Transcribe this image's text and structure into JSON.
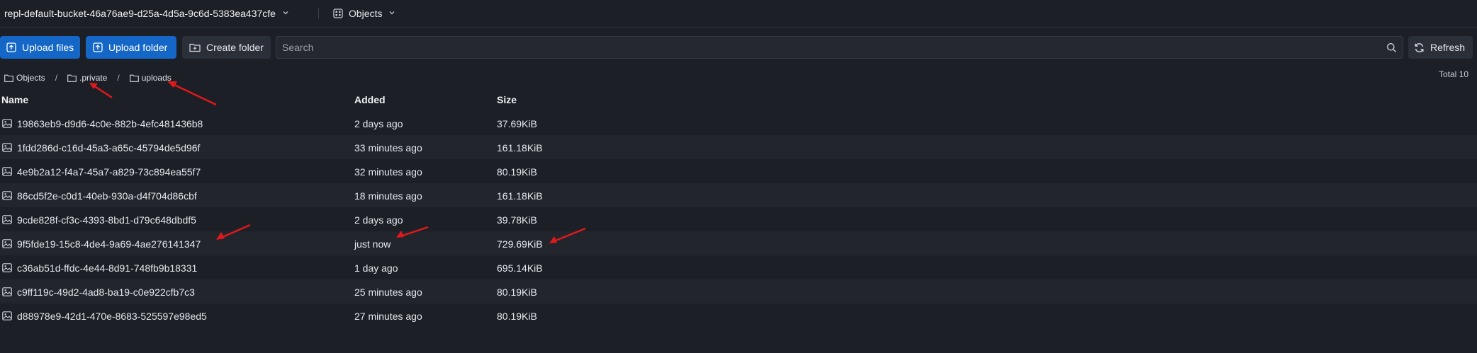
{
  "header": {
    "bucket_name": "repl-default-bucket-46a76ae9-d25a-4d5a-9c6d-5383ea437cfe",
    "view_label": "Objects"
  },
  "toolbar": {
    "upload_files_label": "Upload files",
    "upload_folder_label": "Upload folder",
    "create_folder_label": "Create folder",
    "search_placeholder": "Search",
    "refresh_label": "Refresh"
  },
  "breadcrumb": {
    "items": [
      "Objects",
      ".private",
      "uploads"
    ],
    "separator": "/"
  },
  "total_label": "Total 10",
  "table": {
    "columns": [
      "Name",
      "Added",
      "Size"
    ],
    "rows": [
      {
        "name": "19863eb9-d9d6-4c0e-882b-4efc481436b8",
        "added": "2 days ago",
        "size": "37.69KiB"
      },
      {
        "name": "1fdd286d-c16d-45a3-a65c-45794de5d96f",
        "added": "33 minutes ago",
        "size": "161.18KiB"
      },
      {
        "name": "4e9b2a12-f4a7-45a7-a829-73c894ea55f7",
        "added": "32 minutes ago",
        "size": "80.19KiB"
      },
      {
        "name": "86cd5f2e-c0d1-40eb-930a-d4f704d86cbf",
        "added": "18 minutes ago",
        "size": "161.18KiB"
      },
      {
        "name": "9cde828f-cf3c-4393-8bd1-d79c648dbdf5",
        "added": "2 days ago",
        "size": "39.78KiB"
      },
      {
        "name": "9f5fde19-15c8-4de4-9a69-4ae276141347",
        "added": "just now",
        "size": "729.69KiB"
      },
      {
        "name": "c36ab51d-ffdc-4e44-8d91-748fb9b18331",
        "added": "1 day ago",
        "size": "695.14KiB"
      },
      {
        "name": "c9ff119c-49d2-4ad8-ba19-c0e922cfb7c3",
        "added": "25 minutes ago",
        "size": "80.19KiB"
      },
      {
        "name": "d88978e9-42d1-470e-8683-525597e98ed5",
        "added": "27 minutes ago",
        "size": "80.19KiB"
      }
    ]
  },
  "colors": {
    "background": "#1c1f26",
    "primary_button": "#1466c7",
    "annotation_arrow": "#e0191c"
  },
  "icons": [
    "chevron-down-icon",
    "grid-icon",
    "upload-icon",
    "folder-plus-icon",
    "search-icon",
    "refresh-icon",
    "folder-icon",
    "image-file-icon"
  ]
}
